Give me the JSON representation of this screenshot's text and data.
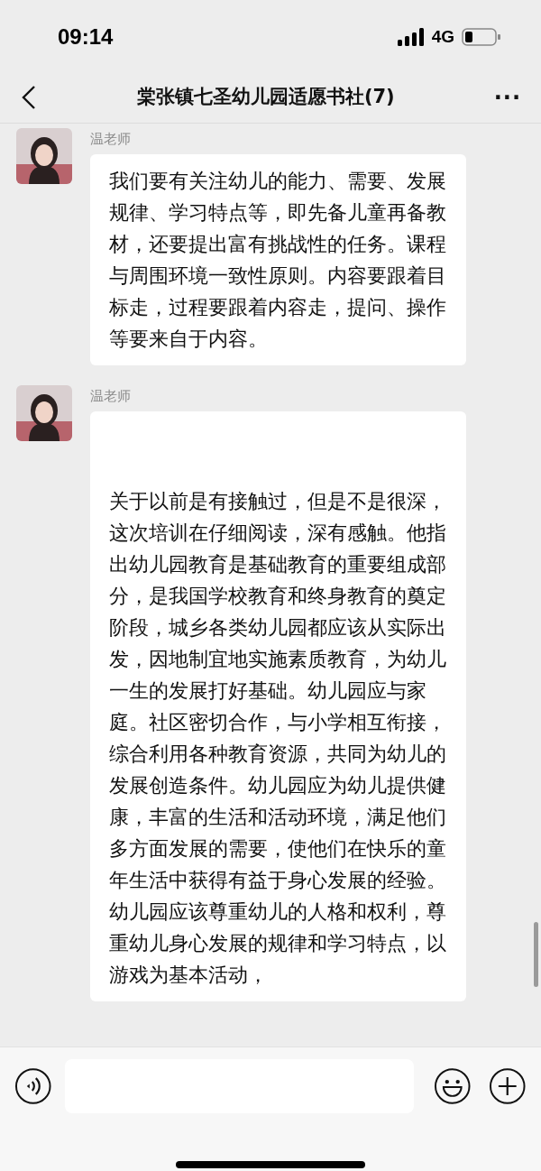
{
  "status_bar": {
    "time": "09:14",
    "network": "4G"
  },
  "header": {
    "title": "棠张镇七圣幼儿园适愿书社(7)",
    "more": "···"
  },
  "messages": [
    {
      "sender": "温老师",
      "text": "我们要有关注幼儿的能力、需要、发展规律、学习特点等，即先备儿童再备教材，还要提出富有挑战性的任务。课程与周围环境一致性原则。内容要跟着目标走，过程要跟着内容走，提问、操作等要来自于内容。"
    },
    {
      "sender": "温老师",
      "text": "\n\n关于以前是有接触过，但是不是很深，这次培训在仔细阅读，深有感触。他指出幼儿园教育是基础教育的重要组成部分，是我国学校教育和终身教育的奠定阶段，城乡各类幼儿园都应该从实际出发，因地制宜地实施素质教育，为幼儿一生的发展打好基础。幼儿园应与家庭。社区密切合作，与小学相互衔接，综合利用各种教育资源，共同为幼儿的发展创造条件。幼儿园应为幼儿提供健康，丰富的生活和活动环境，满足他们多方面发展的需要，使他们在快乐的童年生活中获得有益于身心发展的经验。幼儿园应该尊重幼儿的人格和权利，尊重幼儿身心发展的规律和学习特点，以游戏为基本活动，"
    }
  ]
}
